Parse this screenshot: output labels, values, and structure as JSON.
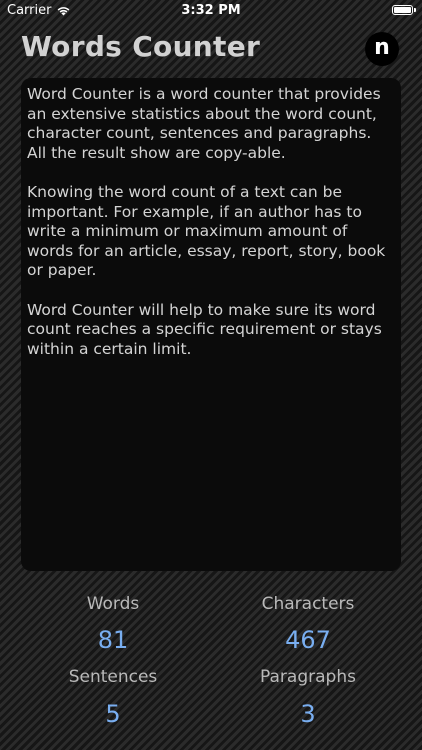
{
  "status_bar": {
    "carrier": "Carrier",
    "time": "3:32 PM"
  },
  "app": {
    "title": "Words Counter",
    "logo_letter": "n"
  },
  "text_input": {
    "paragraphs": [
      "Word Counter is a word counter that provides an extensive statistics about the word count, character count, sentences and paragraphs. All the result show are copy-able.",
      "Knowing the word count of a text can be important. For example, if an author has to write a minimum or maximum amount of words for an article, essay, report, story, book or paper.",
      "Word Counter will help to make sure its word count reaches a specific requirement or stays within a certain limit."
    ]
  },
  "stats": {
    "words": {
      "label": "Words",
      "value": "81"
    },
    "characters": {
      "label": "Characters",
      "value": "467"
    },
    "sentences": {
      "label": "Sentences",
      "value": "5"
    },
    "paragraphs": {
      "label": "Paragraphs",
      "value": "3"
    }
  },
  "colors": {
    "accent": "#79aef0",
    "background": "#222222",
    "text_area": "#0b0b0b"
  },
  "icons": [
    "wifi-icon",
    "battery-icon"
  ]
}
